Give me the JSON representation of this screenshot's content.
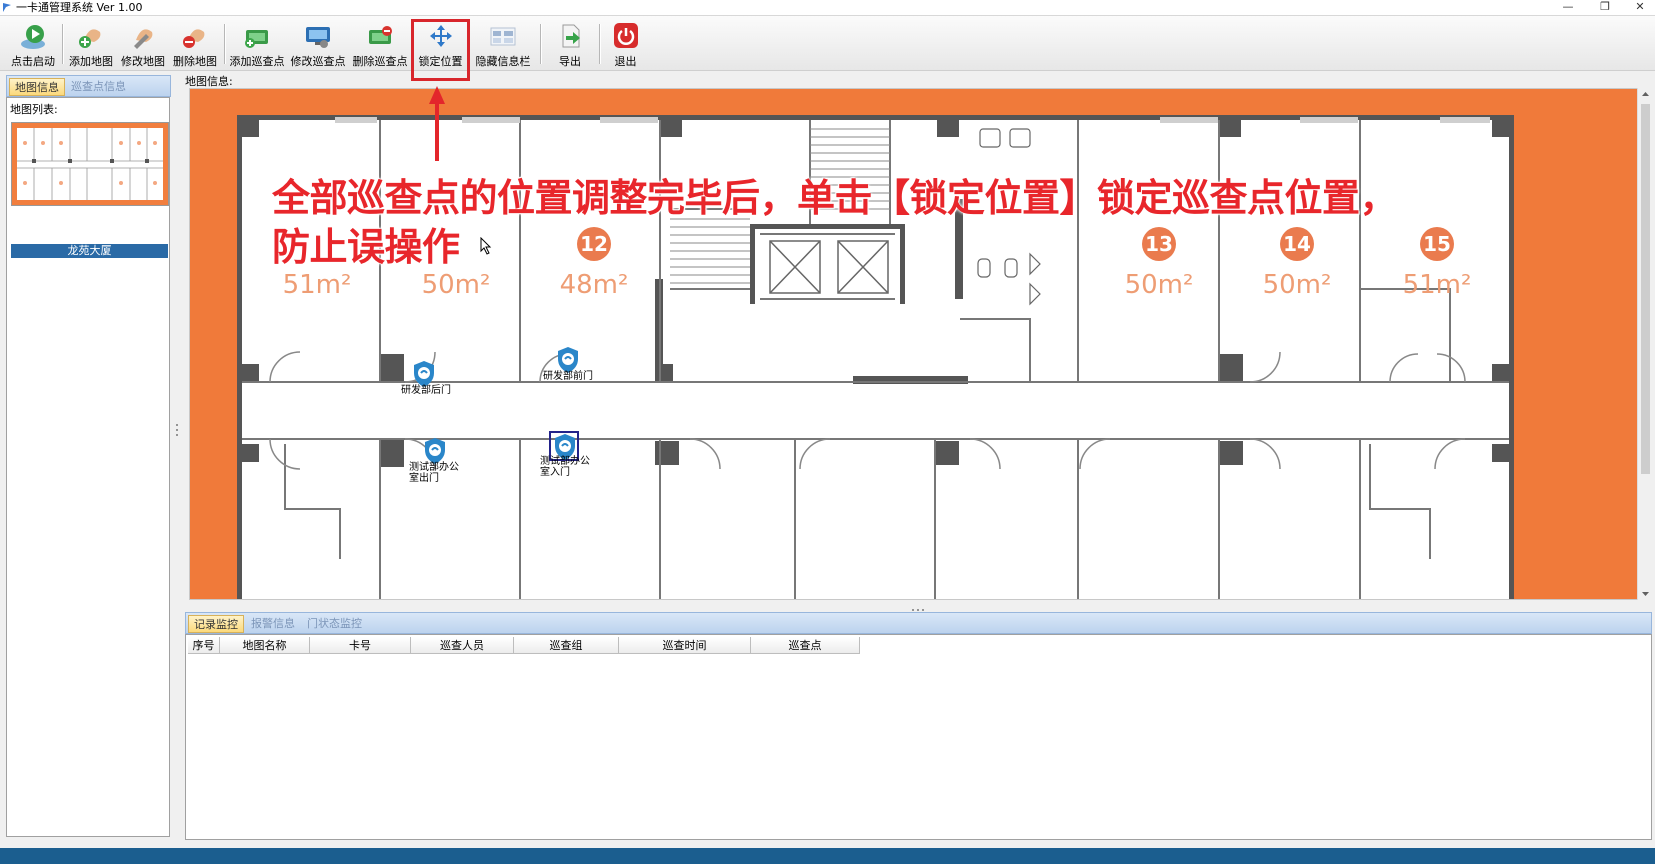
{
  "window": {
    "title": "一卡通管理系统  Ver 1.00",
    "min_glyph": "—",
    "max_glyph": "❐",
    "close_glyph": "✕"
  },
  "toolbar": {
    "start": "点击启动",
    "add_map": "添加地图",
    "edit_map": "修改地图",
    "delete_map": "删除地图",
    "add_checkpoint": "添加巡查点",
    "edit_checkpoint": "修改巡查点",
    "delete_checkpoint": "删除巡查点",
    "lock_position": "锁定位置",
    "hide_info_bar": "隐藏信息栏",
    "export": "导出",
    "exit": "退出"
  },
  "left_panel": {
    "tab_map_info": "地图信息",
    "tab_checkpoint_info": "巡查点信息",
    "map_list_label": "地图列表:",
    "maps": [
      {
        "name": "龙苑大厦"
      }
    ]
  },
  "map": {
    "label": "地图信息:",
    "rooms": [
      {
        "number": "",
        "area": "51m²"
      },
      {
        "number": "",
        "area": "50m²"
      },
      {
        "number": "12",
        "area": "48m²"
      },
      {
        "number": "13",
        "area": "50m²"
      },
      {
        "number": "14",
        "area": "50m²"
      },
      {
        "number": "15",
        "area": "51m²"
      }
    ],
    "checkpoints": [
      {
        "name": "研发部后门"
      },
      {
        "name": "研发部前门"
      },
      {
        "name": "测试部办公室出门"
      },
      {
        "name": "测试部办公室入门"
      }
    ],
    "colors": {
      "border": "#f07a3a",
      "wall": "#555555",
      "room_number": "#ea7b4e"
    }
  },
  "annotation": {
    "line1": "全部巡查点的位置调整完毕后，单击【锁定位置】锁定巡查点位置，",
    "line2": "防止误操作",
    "color": "#e8262b"
  },
  "bottom_panel": {
    "tabs": [
      "记录监控",
      "报警信息",
      "门状态监控"
    ],
    "columns": [
      "序号",
      "地图名称",
      "卡号",
      "巡查人员",
      "巡查组",
      "巡查时间",
      "巡查点"
    ]
  }
}
